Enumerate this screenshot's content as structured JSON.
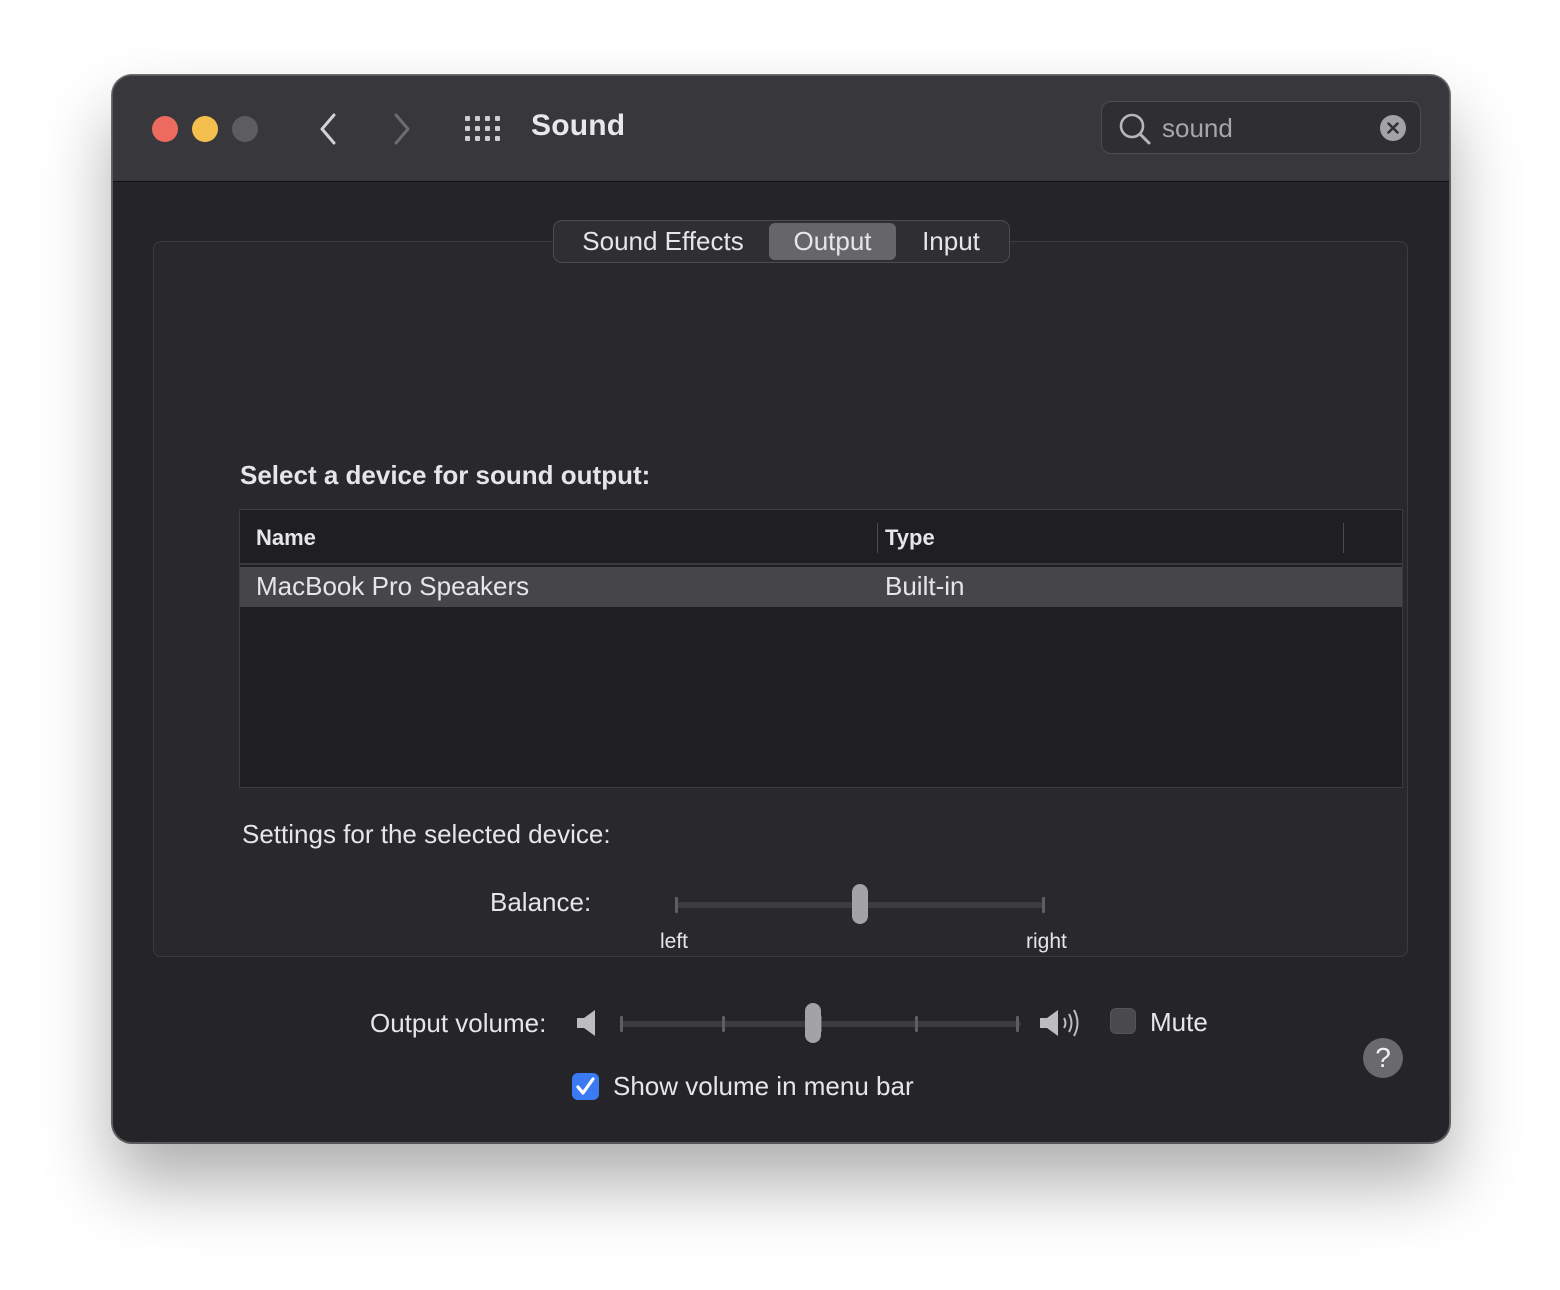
{
  "window": {
    "title": "Sound"
  },
  "toolbar": {
    "back_icon": "chevron-left-icon",
    "forward_icon": "chevron-right-icon",
    "grid_icon": "show-all-grid-icon"
  },
  "search": {
    "value": "sound",
    "icon": "magnifying-glass-icon",
    "clear_icon": "clear-circle-x-icon"
  },
  "tabs": [
    {
      "label": "Sound Effects",
      "selected": false
    },
    {
      "label": "Output",
      "selected": true
    },
    {
      "label": "Input",
      "selected": false
    }
  ],
  "output": {
    "section_title": "Select a device for sound output:",
    "table": {
      "columns": [
        "Name",
        "Type"
      ],
      "rows": [
        {
          "name": "MacBook Pro Speakers",
          "type": "Built-in",
          "selected": true
        }
      ]
    },
    "settings_label": "Settings for the selected device:",
    "balance": {
      "label": "Balance:",
      "left_label": "left",
      "right_label": "right",
      "value": 0.5
    }
  },
  "volume": {
    "label": "Output volume:",
    "value": 0.48,
    "low_icon": "speaker-low-icon",
    "high_icon": "speaker-high-icon",
    "mute_label": "Mute",
    "mute_checked": false
  },
  "menu_bar": {
    "label": "Show volume in menu bar",
    "checked": true
  },
  "colors": {
    "accent": "#3a7bf4",
    "close": "#ed6a5e",
    "minimize": "#f4bf4f",
    "zoom": "#5d5c61",
    "window_bg": "#252428",
    "titlebar_bg": "#38373c"
  }
}
